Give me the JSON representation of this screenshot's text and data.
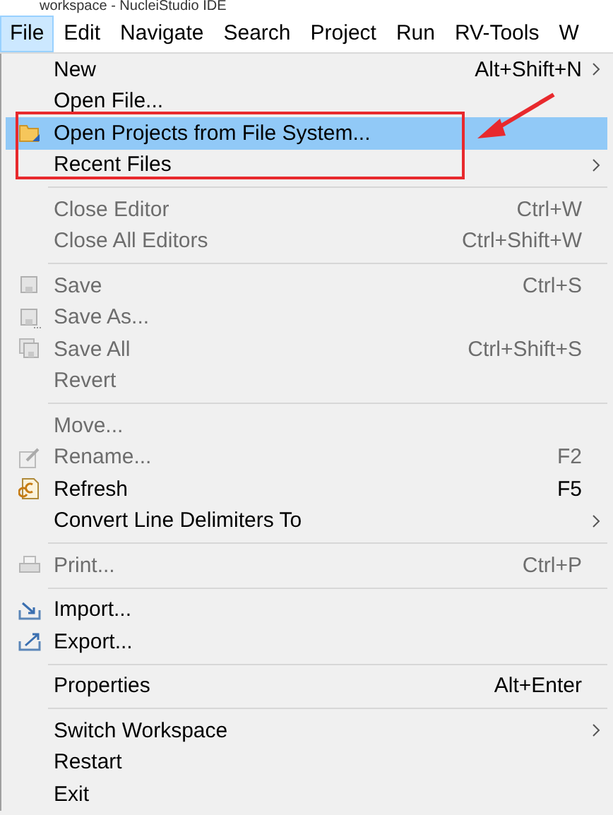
{
  "window": {
    "title": "workspace - NucleiStudio IDE"
  },
  "menu_bar": [
    {
      "label": "File",
      "selected": true
    },
    {
      "label": "Edit",
      "selected": false
    },
    {
      "label": "Navigate",
      "selected": false
    },
    {
      "label": "Search",
      "selected": false
    },
    {
      "label": "Project",
      "selected": false
    },
    {
      "label": "Run",
      "selected": false
    },
    {
      "label": "RV-Tools",
      "selected": false
    },
    {
      "label": "W",
      "selected": false
    }
  ],
  "file_menu": [
    {
      "kind": "item",
      "label": "New",
      "shortcut": "Alt+Shift+N",
      "submenu": true,
      "disabled": false,
      "selected": false
    },
    {
      "kind": "item",
      "label": "Open File...",
      "submenu": false,
      "disabled": false,
      "selected": false
    },
    {
      "kind": "item",
      "label": "Open Projects from File System...",
      "submenu": false,
      "disabled": false,
      "selected": true
    },
    {
      "kind": "item",
      "label": "Recent Files",
      "submenu": true,
      "disabled": false,
      "selected": false
    },
    {
      "kind": "separator"
    },
    {
      "kind": "item",
      "label": "Close Editor",
      "shortcut": "Ctrl+W",
      "submenu": false,
      "disabled": true,
      "selected": false
    },
    {
      "kind": "item",
      "label": "Close All Editors",
      "shortcut": "Ctrl+Shift+W",
      "submenu": false,
      "disabled": true,
      "selected": false
    },
    {
      "kind": "separator"
    },
    {
      "kind": "item",
      "label": "Save",
      "shortcut": "Ctrl+S",
      "submenu": false,
      "disabled": true,
      "selected": false
    },
    {
      "kind": "item",
      "label": "Save As...",
      "submenu": false,
      "disabled": true,
      "selected": false
    },
    {
      "kind": "item",
      "label": "Save All",
      "shortcut": "Ctrl+Shift+S",
      "submenu": false,
      "disabled": true,
      "selected": false
    },
    {
      "kind": "item",
      "label": "Revert",
      "submenu": false,
      "disabled": true,
      "selected": false
    },
    {
      "kind": "separator"
    },
    {
      "kind": "item",
      "label": "Move...",
      "submenu": false,
      "disabled": true,
      "selected": false
    },
    {
      "kind": "item",
      "label": "Rename...",
      "shortcut": "F2",
      "submenu": false,
      "disabled": true,
      "selected": false
    },
    {
      "kind": "item",
      "label": "Refresh",
      "shortcut": "F5",
      "submenu": false,
      "disabled": false,
      "selected": false
    },
    {
      "kind": "item",
      "label": "Convert Line Delimiters To",
      "submenu": true,
      "disabled": false,
      "selected": false
    },
    {
      "kind": "separator"
    },
    {
      "kind": "item",
      "label": "Print...",
      "shortcut": "Ctrl+P",
      "submenu": false,
      "disabled": true,
      "selected": false
    },
    {
      "kind": "separator"
    },
    {
      "kind": "item",
      "label": "Import...",
      "submenu": false,
      "disabled": false,
      "selected": false
    },
    {
      "kind": "item",
      "label": "Export...",
      "submenu": false,
      "disabled": false,
      "selected": false
    },
    {
      "kind": "separator"
    },
    {
      "kind": "item",
      "label": "Properties",
      "shortcut": "Alt+Enter",
      "submenu": false,
      "disabled": false,
      "selected": false
    },
    {
      "kind": "separator"
    },
    {
      "kind": "item",
      "label": "Switch Workspace",
      "submenu": true,
      "disabled": false,
      "selected": false
    },
    {
      "kind": "item",
      "label": "Restart",
      "submenu": false,
      "disabled": false,
      "selected": false
    },
    {
      "kind": "item",
      "label": "Exit",
      "submenu": false,
      "disabled": false,
      "selected": false
    }
  ]
}
